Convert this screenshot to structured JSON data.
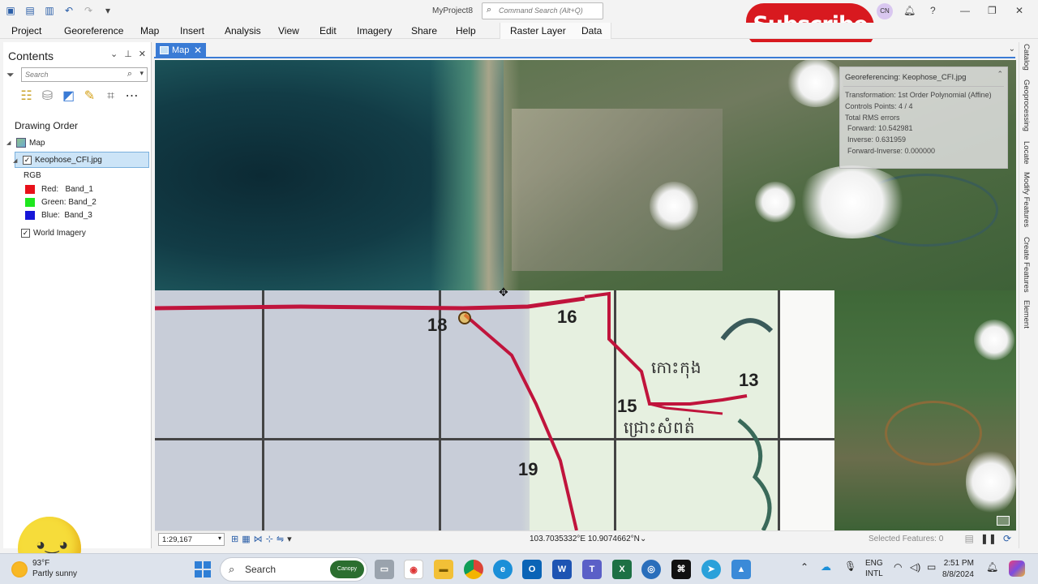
{
  "titlebar": {
    "project_title": "MyProject8",
    "command_search_placeholder": "Command Search (Alt+Q)",
    "avatar_initials": "CN",
    "subscribe_label": "Subscribe",
    "help_glyph": "?"
  },
  "menu": {
    "items": [
      "Project",
      "Georeference",
      "Map",
      "Insert",
      "Analysis",
      "View",
      "Edit",
      "Imagery",
      "Share",
      "Help"
    ],
    "contextual": [
      "Raster Layer",
      "Data"
    ]
  },
  "contents": {
    "title": "Contents",
    "search_placeholder": "Search",
    "section": "Drawing Order",
    "map_label": "Map",
    "layer_name": "Keophose_CFI.jpg",
    "render_type": "RGB",
    "bands": [
      {
        "label": "Red:   Band_1",
        "color": "#e8101a"
      },
      {
        "label": "Green: Band_2",
        "color": "#1ee61e"
      },
      {
        "label": "Blue:  Band_3",
        "color": "#1616d8"
      }
    ],
    "basemap_name": "World Imagery"
  },
  "map_tab": {
    "label": "Map"
  },
  "georef_panel": {
    "title": "Georeferencing: Keophose_CFI.jpg",
    "transformation": "Transformation: 1st Order Polynomial (Affine)",
    "control_points": "Controls Points: 4 / 4",
    "rms_header": "Total RMS errors",
    "forward": "Forward: 10.542981",
    "inverse": "Inverse: 0.631959",
    "forward_inverse": "Forward-Inverse: 0.000000"
  },
  "scan_labels": {
    "n18": "18",
    "n16": "16",
    "n13": "13",
    "n15": "15",
    "n19": "19",
    "khmer1": "កោះកុង",
    "khmer2": "ជ្រោះសំពត់"
  },
  "statusbar": {
    "scale": "1:29,167",
    "coordinates": "103.7035332°E 10.9074662°N",
    "selected_features": "Selected Features: 0"
  },
  "right_dock": [
    "Catalog",
    "Geoprocessing",
    "Locate",
    "Modify Features",
    "Create Features",
    "Element"
  ],
  "taskbar": {
    "temperature": "93°F",
    "weather": "Partly sunny",
    "search_label": "Search",
    "search_badge": "Canopy",
    "lang_top": "ENG",
    "lang_bottom": "INTL",
    "time": "2:51 PM",
    "date": "8/8/2024"
  },
  "colors": {
    "accent": "#3a7bd5",
    "road_red": "#c0143c",
    "subscribe_red": "#d8191f"
  }
}
